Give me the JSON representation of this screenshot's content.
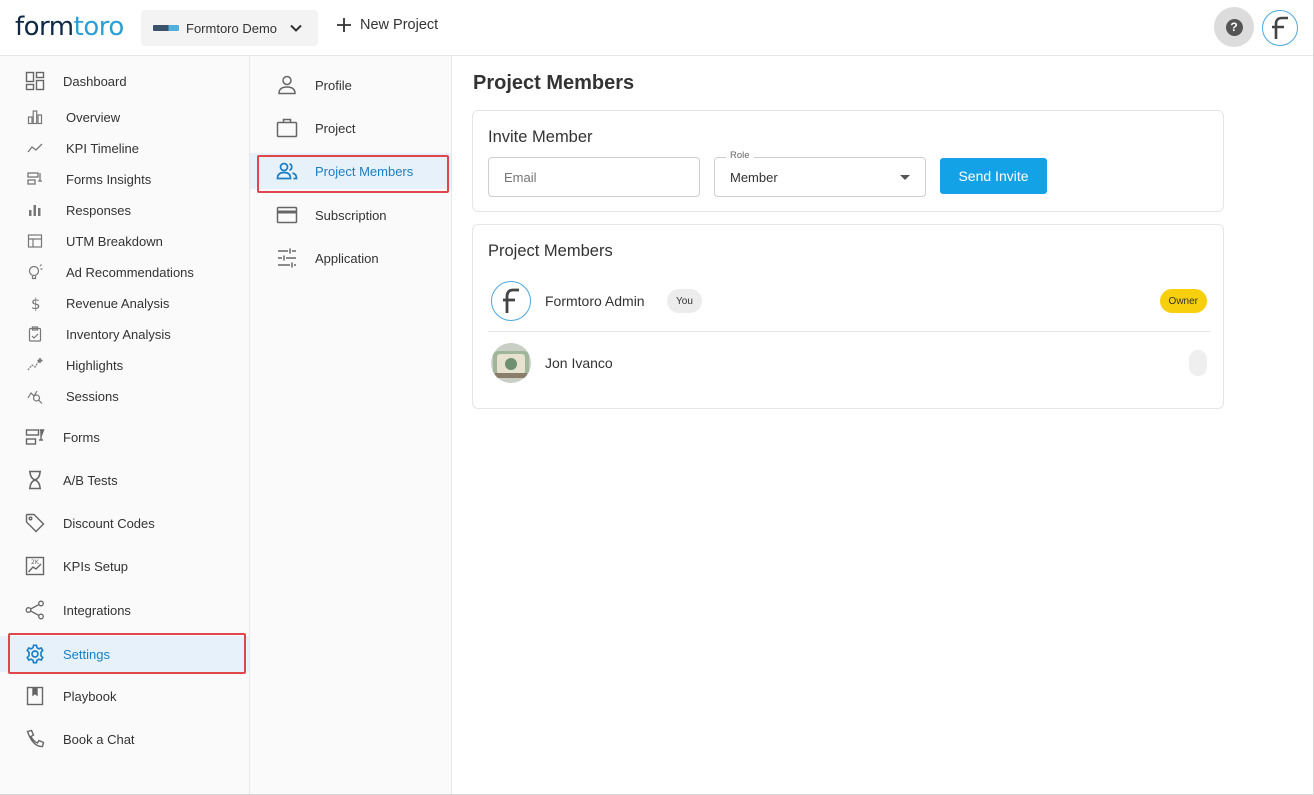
{
  "header": {
    "logo_main": "form",
    "logo_tail": "toro",
    "project_name": "Formtoro Demo",
    "new_project_label": "New Project",
    "help_label": "?",
    "avatar_letter": "F"
  },
  "sidebar": {
    "items": [
      {
        "label": "Dashboard",
        "icon": "dashboard-icon"
      },
      {
        "label": "Overview",
        "icon": "bar-chart-icon"
      },
      {
        "label": "KPI Timeline",
        "icon": "line-trend-icon"
      },
      {
        "label": "Forms Insights",
        "icon": "forms-insights-icon"
      },
      {
        "label": "Responses",
        "icon": "bars-icon"
      },
      {
        "label": "UTM Breakdown",
        "icon": "table-icon"
      },
      {
        "label": "Ad Recommendations",
        "icon": "lightbulb-icon"
      },
      {
        "label": "Revenue Analysis",
        "icon": "dollar-icon"
      },
      {
        "label": "Inventory Analysis",
        "icon": "clipboard-icon"
      },
      {
        "label": "Highlights",
        "icon": "sparkline-icon"
      },
      {
        "label": "Sessions",
        "icon": "search-chart-icon"
      },
      {
        "label": "Forms",
        "icon": "forms-icon"
      },
      {
        "label": "A/B Tests",
        "icon": "hourglass-icon"
      },
      {
        "label": "Discount Codes",
        "icon": "tag-icon"
      },
      {
        "label": "KPIs Setup",
        "icon": "kpi-chart-icon"
      },
      {
        "label": "Integrations",
        "icon": "share-icon"
      },
      {
        "label": "Settings",
        "icon": "gear-icon"
      },
      {
        "label": "Playbook",
        "icon": "book-icon"
      },
      {
        "label": "Book a Chat",
        "icon": "phone-icon"
      }
    ],
    "active": "Settings"
  },
  "settings_menu": {
    "items": [
      {
        "label": "Profile",
        "icon": "person-icon"
      },
      {
        "label": "Project",
        "icon": "briefcase-icon"
      },
      {
        "label": "Project Members",
        "icon": "people-icon"
      },
      {
        "label": "Subscription",
        "icon": "credit-card-icon"
      },
      {
        "label": "Application",
        "icon": "sliders-icon"
      }
    ],
    "active": "Project Members"
  },
  "main": {
    "title": "Project Members",
    "invite": {
      "title": "Invite Member",
      "email_placeholder": "Email",
      "role_label": "Role",
      "role_value": "Member",
      "send_label": "Send Invite"
    },
    "members_card": {
      "title": "Project Members",
      "members": [
        {
          "name": "Formtoro Admin",
          "tag": "You",
          "role_badge": "Owner",
          "avatar": "F"
        },
        {
          "name": "Jon Ivanco",
          "tag": "",
          "role_badge": "",
          "avatar": "photo"
        }
      ]
    }
  },
  "colors": {
    "accent": "#13a2e6",
    "active_text": "#1a7fc4",
    "highlight_border": "#e0474c",
    "owner_badge": "#f8cf0d"
  }
}
